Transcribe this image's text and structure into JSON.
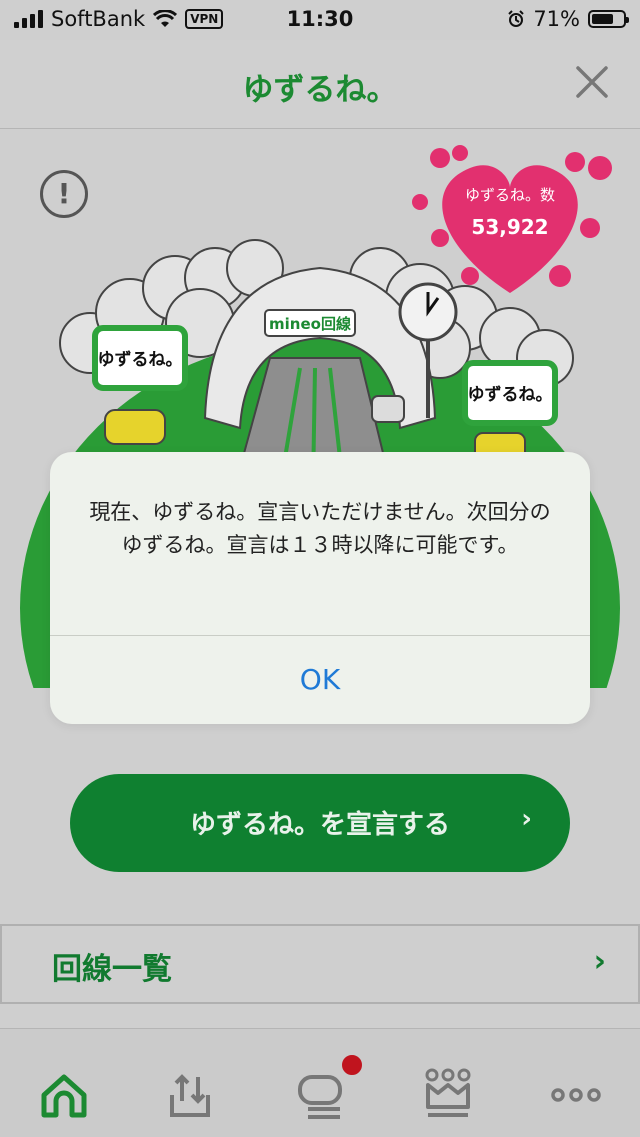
{
  "status_bar": {
    "carrier": "SoftBank",
    "vpn": "VPN",
    "time": "11:30",
    "battery": "71%",
    "battery_level": 0.71
  },
  "nav": {
    "title": "ゆずるね。",
    "close_icon": "close-icon"
  },
  "hero": {
    "info_icon": "exclamation-icon",
    "heart_label": "ゆずるね。数",
    "heart_value": "53,922",
    "sign_text": "mineo回線",
    "bubble_text": "ゆずるね。"
  },
  "alert": {
    "message": "現在、ゆずるね。宣言いただけません。次回分のゆずるね。宣言は１３時以降に可能です。",
    "ok_label": "OK"
  },
  "declare": {
    "label": "ゆずるね。を宣言する",
    "chevron": "›"
  },
  "lines": {
    "label": "回線一覧",
    "chevron": "›"
  },
  "tabs": [
    {
      "name": "home-icon"
    },
    {
      "name": "upload-icon"
    },
    {
      "name": "chat-icon",
      "badge": true
    },
    {
      "name": "crown-icon"
    },
    {
      "name": "more-icon"
    }
  ],
  "colors": {
    "brand_green": "#1c8a32",
    "heart_pink": "#c82a6e",
    "ok_blue": "#1f7ad6",
    "badge_red": "#c0141e"
  }
}
